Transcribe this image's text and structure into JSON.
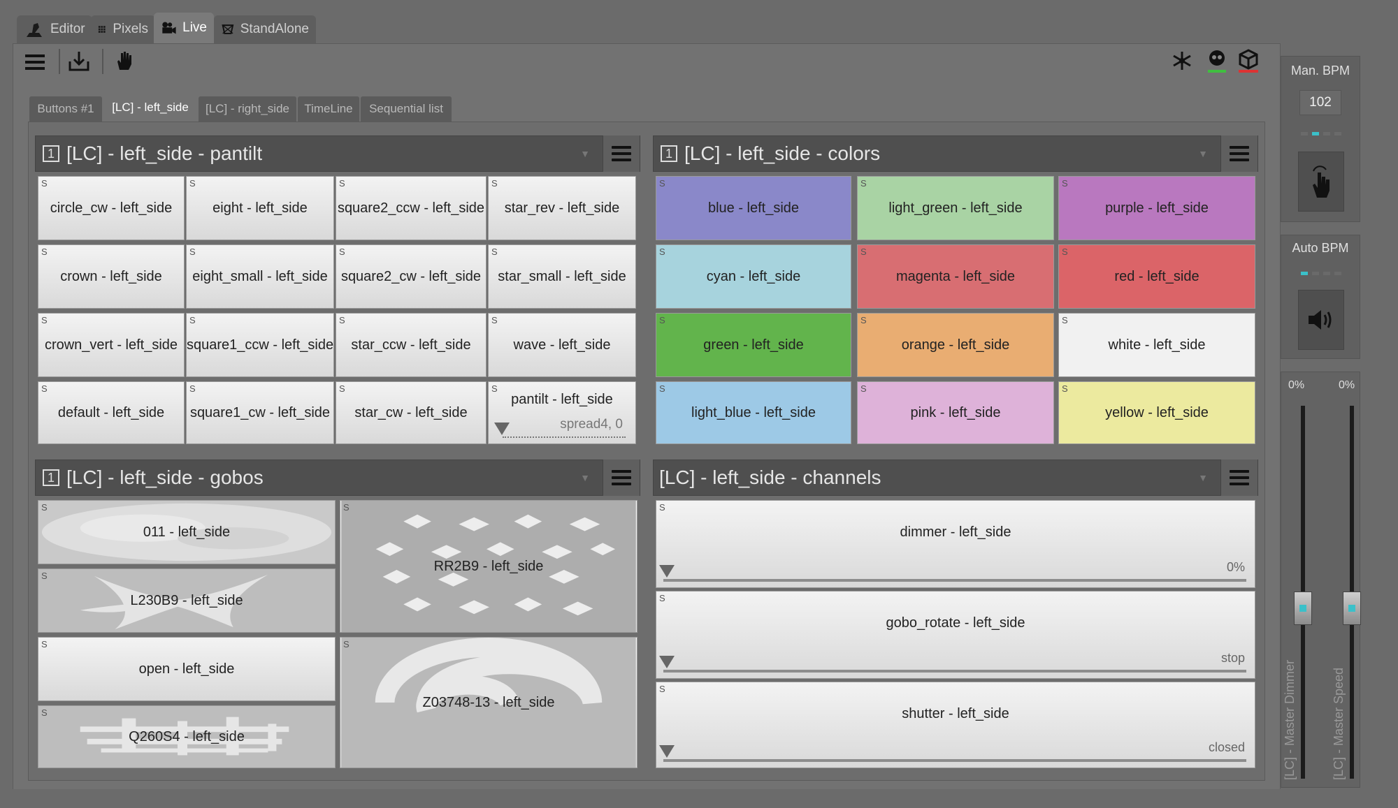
{
  "mode_tabs": [
    {
      "label": "Editor",
      "icon": "editor-icon"
    },
    {
      "label": "Pixels",
      "icon": "pixels-icon"
    },
    {
      "label": "Live",
      "icon": "camera-icon"
    },
    {
      "label": "StandAlone",
      "icon": "standalone-icon"
    }
  ],
  "sub_tabs": [
    "Buttons #1",
    "[LC] - left_side",
    "[LC] - right_side",
    "TimeLine",
    "Sequential list"
  ],
  "pantilt": {
    "number": "1",
    "title": "[LC] - left_side - pantilt",
    "buttons": [
      "circle_cw - left_side",
      "eight - left_side",
      "square2_ccw - left_side",
      "star_rev - left_side",
      "crown - left_side",
      "eight_small - left_side",
      "square2_cw - left_side",
      "star_small - left_side",
      "crown_vert - left_side",
      "square1_ccw - left_side",
      "star_ccw - left_side",
      "wave - left_side",
      "default - left_side",
      "square1_cw - left_side",
      "star_cw - left_side",
      "pantilt - left_side"
    ],
    "pantilt_value": "spread4, 0"
  },
  "colors": {
    "number": "1",
    "title": "[LC] - left_side - colors",
    "buttons": [
      {
        "label": "blue - left_side",
        "color": "#8a88c9"
      },
      {
        "label": "light_green - left_side",
        "color": "#a9d3a4"
      },
      {
        "label": "purple - left_side",
        "color": "#b978bf"
      },
      {
        "label": "cyan - left_side",
        "color": "#a7d3dd"
      },
      {
        "label": "magenta - left_side",
        "color": "#d86e72"
      },
      {
        "label": "red - left_side",
        "color": "#db6468"
      },
      {
        "label": "green - left_side",
        "color": "#62b44c"
      },
      {
        "label": "orange - left_side",
        "color": "#e9ad72"
      },
      {
        "label": "white - left_side",
        "color": "#f1f1f1"
      },
      {
        "label": "light_blue - left_side",
        "color": "#9dc9e6"
      },
      {
        "label": "pink - left_side",
        "color": "#deb2d9"
      },
      {
        "label": "yellow - left_side",
        "color": "#ecea9f"
      }
    ]
  },
  "gobos": {
    "number": "1",
    "title": "[LC] - left_side - gobos",
    "buttons": [
      "011 - left_side",
      "L230B9 - left_side",
      "open - left_side",
      "Q260S4 - left_side",
      "RR2B9 - left_side",
      "Z03748-13 - left_side"
    ]
  },
  "channels": {
    "title": "[LC] - left_side - channels",
    "items": [
      {
        "label": "dimmer - left_side",
        "value": "0%"
      },
      {
        "label": "gobo_rotate - left_side",
        "value": "stop"
      },
      {
        "label": "shutter - left_side",
        "value": "closed"
      }
    ]
  },
  "right_panel": {
    "man_bpm_label": "Man. BPM",
    "man_bpm_value": "102",
    "auto_bpm_label": "Auto BPM",
    "dimmer_pct": "0%",
    "speed_pct": "0%",
    "dimmer_label": "[LC] - Master Dimmer",
    "speed_label": "[LC] - Master Speed",
    "dimmer_level": 0,
    "speed_level": 0
  }
}
